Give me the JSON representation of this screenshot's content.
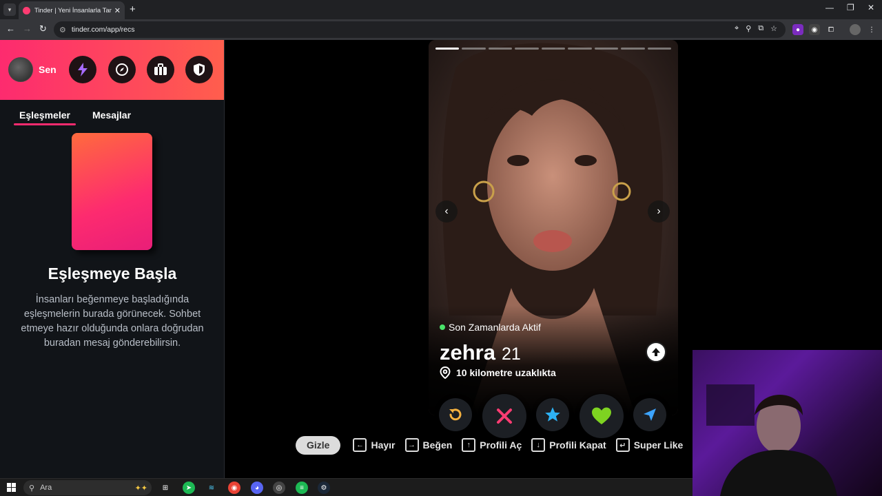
{
  "browser": {
    "tab_title": "Tinder | Yeni İnsanlarla Tanış, Bu",
    "url": "tinder.com/app/recs"
  },
  "sidebar": {
    "user_label": "Sen",
    "tabs": [
      {
        "label": "Eşleşmeler",
        "active": true
      },
      {
        "label": "Mesajlar",
        "active": false
      }
    ],
    "empty_title": "Eşleşmeye Başla",
    "empty_desc": "İnsanları beğenmeye başladığında eşleşmelerin burada görünecek. Sohbet etmeye hazır olduğunda onlara doğrudan buradan mesaj gönderebilirsin.",
    "header_icons": [
      "bolt-icon",
      "compass-icon",
      "briefcase-icon",
      "shield-icon"
    ]
  },
  "profile": {
    "status": "Son Zamanlarda Aktif",
    "name": "zehra",
    "age": "21",
    "distance": "10 kilometre uzaklıkta",
    "photo_count": 9,
    "active_photo_index": 0
  },
  "actions": [
    "rewind-icon",
    "nope-icon",
    "super-like-icon",
    "like-icon",
    "boost-icon"
  ],
  "shortcuts": {
    "hide_label": "Gizle",
    "items": [
      {
        "key": "←",
        "label": "Hayır"
      },
      {
        "key": "→",
        "label": "Beğen"
      },
      {
        "key": "↑",
        "label": "Profili Aç"
      },
      {
        "key": "↓",
        "label": "Profili Kapat"
      },
      {
        "key": "↵",
        "label": "Super Like"
      }
    ]
  },
  "taskbar": {
    "search_placeholder": "Ara"
  },
  "colors": {
    "brand_start": "#fd2b6f",
    "brand_end": "#ff5e4d",
    "online": "#4ae36a",
    "nope": "#fe3c72",
    "super_like": "#2db2f5",
    "like": "#7ed321",
    "boost": "#3ca4ff",
    "rewind": "#f5b13f"
  }
}
